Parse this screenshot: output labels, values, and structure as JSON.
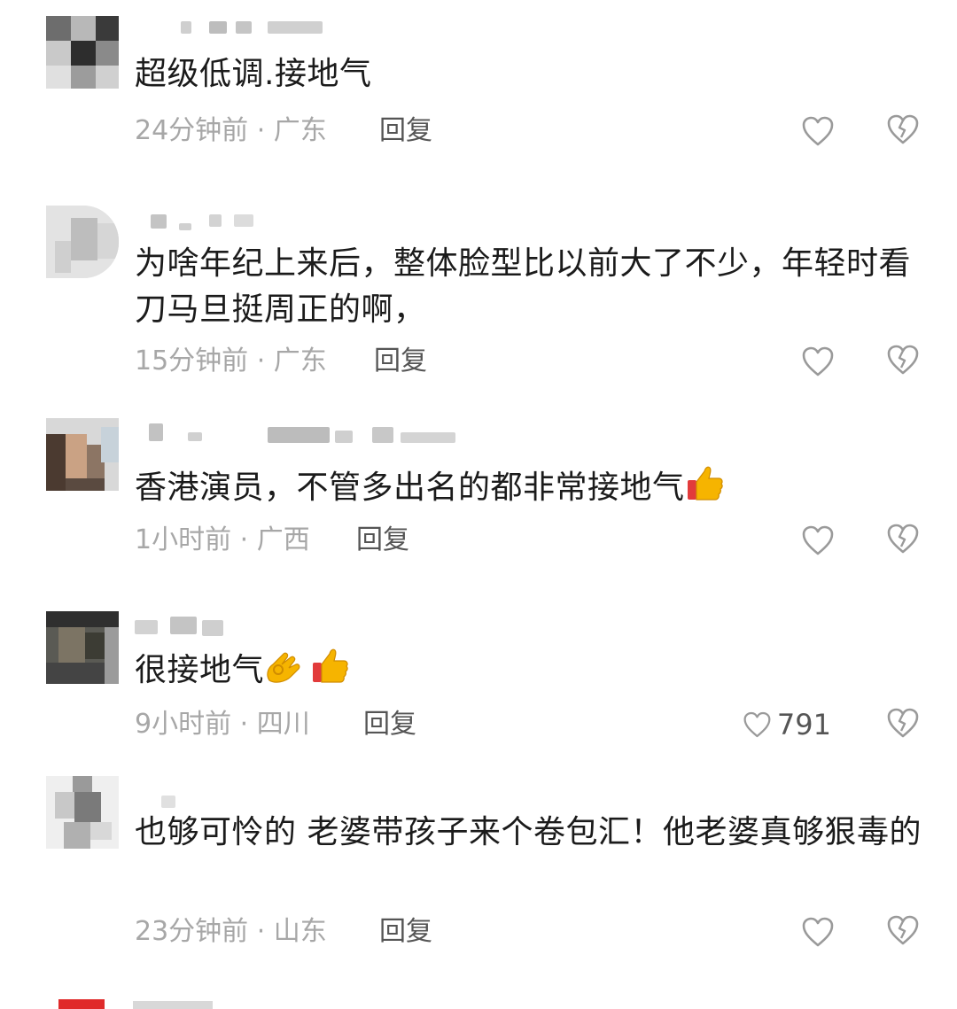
{
  "comments": [
    {
      "text": "超级低调.接地气",
      "time": "24分钟前",
      "location": "广东",
      "reply": "回复",
      "likes": ""
    },
    {
      "text": "为啥年纪上来后，整体脸型比以前大了不少，年轻时看刀马旦挺周正的啊，",
      "time": "15分钟前",
      "location": "广东",
      "reply": "回复",
      "likes": ""
    },
    {
      "text": "香港演员，不管多出名的都非常接地气",
      "time": "1小时前",
      "location": "广西",
      "reply": "回复",
      "likes": ""
    },
    {
      "text": "很接地气",
      "time": "9小时前",
      "location": "四川",
      "reply": "回复",
      "likes": "791"
    },
    {
      "text": "也够可怜的 老婆带孩子来个卷包汇！他老婆真够狠毒的",
      "time": "23分钟前",
      "location": "山东",
      "reply": "回复",
      "likes": ""
    }
  ],
  "separator": " · ",
  "icons": {
    "like": "heart-outline-icon",
    "dislike": "broken-heart-icon",
    "thumbs_up": "thumbs-up-emoji",
    "ok_hand": "ok-hand-emoji"
  },
  "colors": {
    "text": "#1b1b1b",
    "meta": "#a7a7a7",
    "reply": "#555555",
    "icon": "#9a9a9a",
    "emoji": "#f6b400"
  }
}
